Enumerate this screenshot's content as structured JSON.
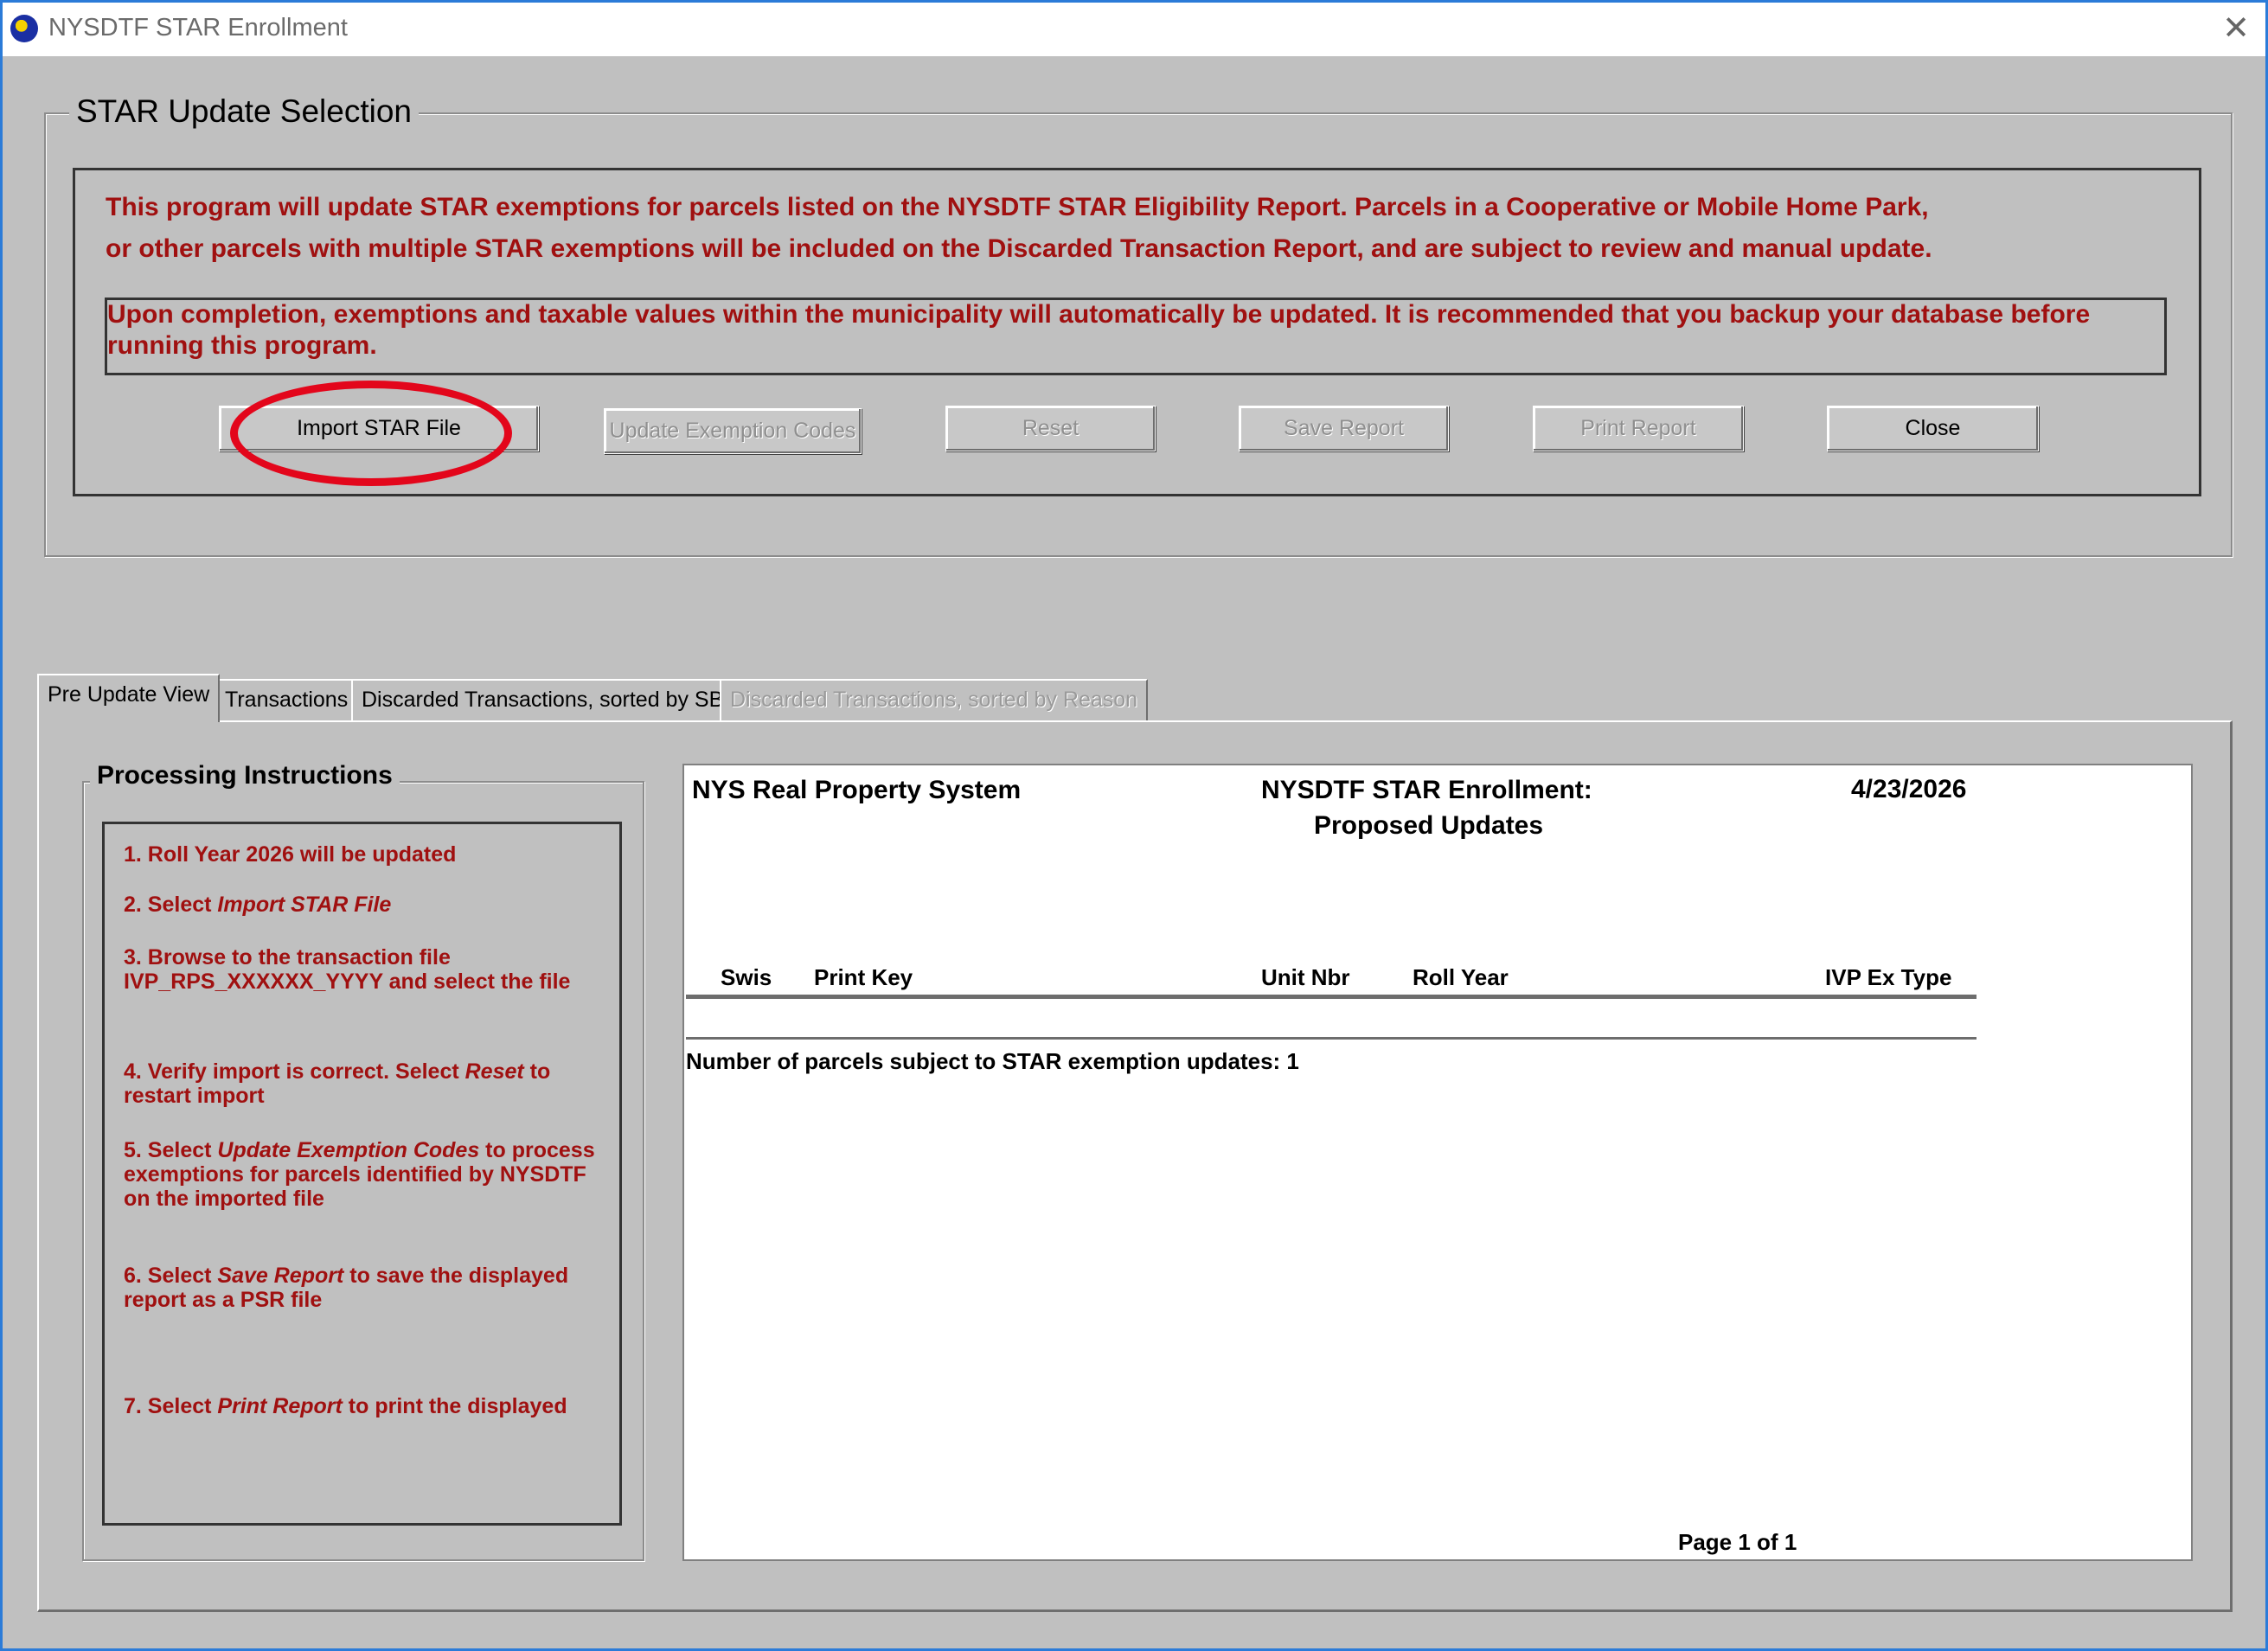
{
  "window": {
    "title": "NYSDTF STAR Enrollment",
    "close_glyph": "✕"
  },
  "update_selection": {
    "legend": "STAR Update Selection",
    "info_line_1": "This program will update STAR exemptions for parcels listed on the NYSDTF STAR Eligibility Report. Parcels in a Cooperative or Mobile Home Park,",
    "info_line_2": "or other parcels with multiple STAR exemptions will be included on the Discarded Transaction Report, and are subject to review and manual update.",
    "warning": "Upon completion, exemptions and taxable values within the municipality will automatically be updated.  It is recommended that you backup your database before running this program.",
    "buttons": {
      "import": "Import STAR File",
      "update": "Update Exemption Codes",
      "reset": "Reset",
      "save": "Save Report",
      "print": "Print Report",
      "close": "Close"
    }
  },
  "tabs": [
    {
      "label": "Pre Update View",
      "selected": true
    },
    {
      "label": "Transactions"
    },
    {
      "label": "Discarded Transactions, sorted by SBL"
    },
    {
      "label": "Discarded Transactions, sorted by Reason",
      "disabled": true
    }
  ],
  "instructions": {
    "legend": "Processing Instructions",
    "s1": "1. Roll Year 2026 will be updated",
    "s2_pre": "2. Select ",
    "s2_em": "Import STAR File",
    "s3": "3. Browse to the transaction file IVP_RPS_XXXXXX_YYYY and select the file",
    "s4_pre": "4. Verify import is correct.  Select ",
    "s4_em": "Reset",
    "s4_post": " to restart import",
    "s5_pre": "5. Select ",
    "s5_em": "Update Exemption Codes",
    "s5_post": "  to process exemptions for parcels identified by NYSDTF on the imported file",
    "s6_pre": "6. Select ",
    "s6_em": "Save Report",
    "s6_post": "  to save the displayed report as a PSR file",
    "s7_pre": "7. Select ",
    "s7_em": "Print Report",
    "s7_post": "  to print the displayed"
  },
  "report": {
    "system": "NYS Real Property System",
    "title": "NYSDTF STAR Enrollment:",
    "subtitle": "Proposed Updates",
    "date": "4/23/2026",
    "columns": [
      "Swis",
      "Print Key",
      "Unit Nbr",
      "Roll Year",
      "IVP Ex Type"
    ],
    "count_text": "Number of parcels subject to STAR exemption updates:  1",
    "page": "Page 1 of 1"
  },
  "colors": {
    "instruction_text": "#a01010",
    "highlight": "#e3061b",
    "window_border": "#2b7bd8"
  }
}
